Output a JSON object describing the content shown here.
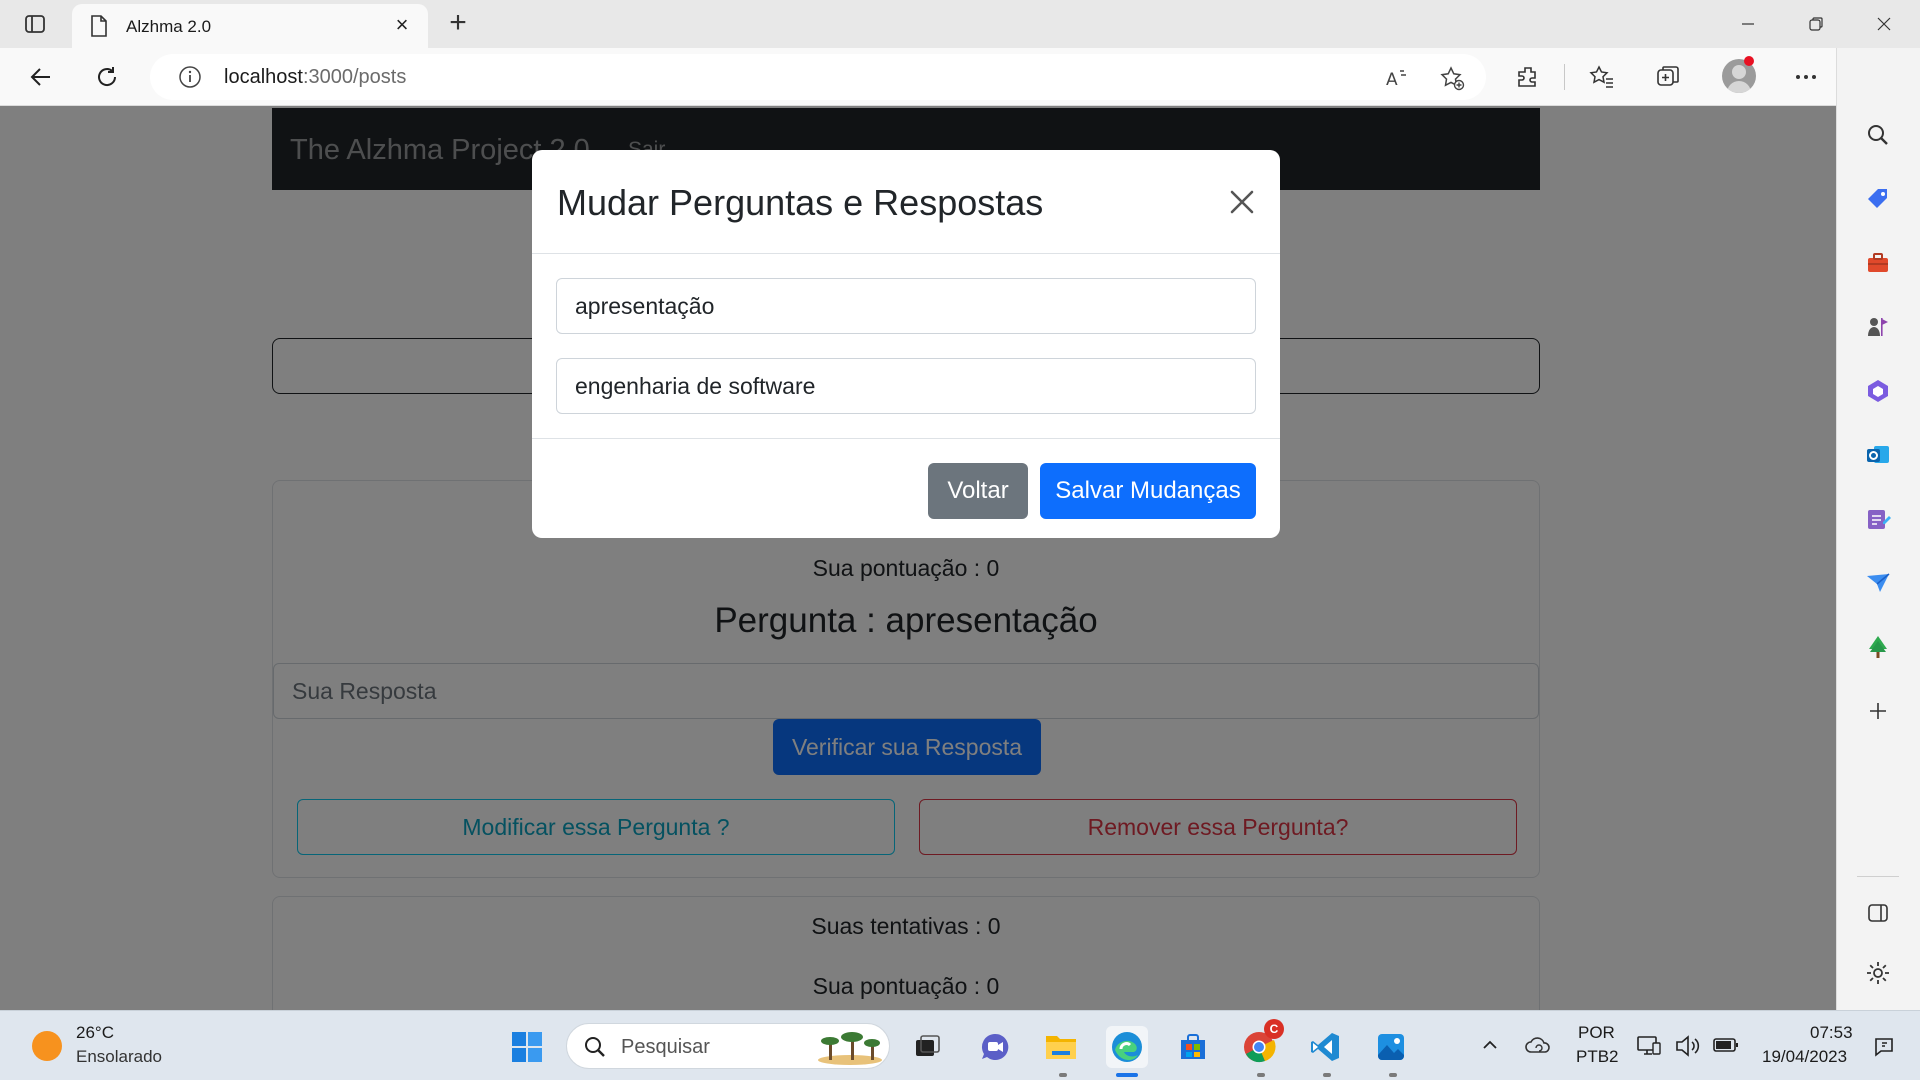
{
  "browser": {
    "tab_title": "Alzhma 2.0",
    "url_host": "localhost",
    "url_path": ":3000/posts"
  },
  "page": {
    "brand": "The Alzhma Project 2.0",
    "nav_link": "Sair",
    "card1": {
      "score": "Sua pontuação : 0",
      "question": "Pergunta : apresentação",
      "answer_placeholder": "Sua Resposta",
      "verify_label": "Verificar sua Resposta",
      "modify_label": "Modificar essa Pergunta ?",
      "remove_label": "Remover essa Pergunta?"
    },
    "card2": {
      "attempts": "Suas tentativas : 0",
      "score": "Sua pontuação : 0"
    }
  },
  "modal": {
    "title": "Mudar Perguntas e Respostas",
    "question_value": "apresentação",
    "answer_value": "engenharia de software",
    "back_label": "Voltar",
    "save_label": "Salvar Mudanças"
  },
  "taskbar": {
    "weather_temp": "26°C",
    "weather_desc": "Ensolarado",
    "search_placeholder": "Pesquisar",
    "lang_1": "POR",
    "lang_2": "PTB2",
    "time": "07:53",
    "date": "19/04/2023",
    "chrome_badge": "C"
  },
  "colors": {
    "primary": "#0d6efd",
    "secondary": "#6c757d",
    "info": "#0dcaf0",
    "danger": "#dc3545",
    "navbar": "#212529"
  }
}
